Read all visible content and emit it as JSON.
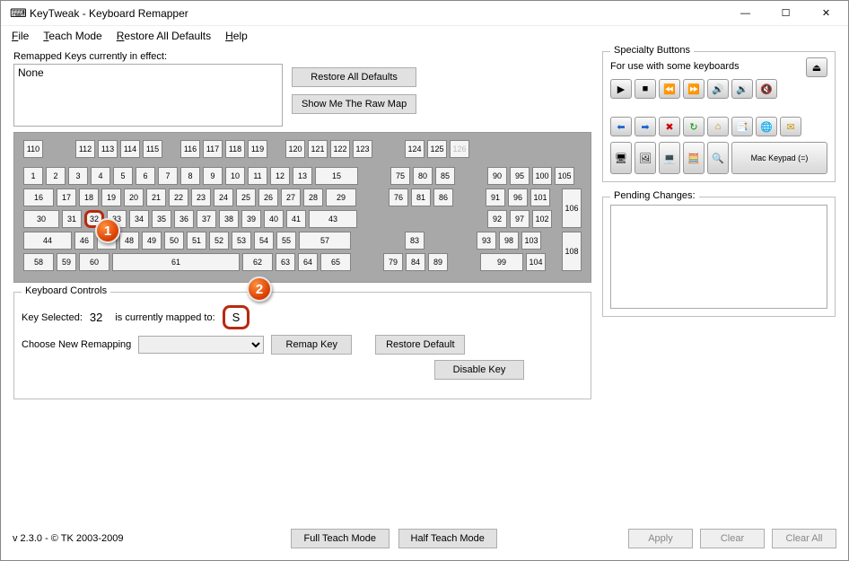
{
  "title": "KeyTweak -   Keyboard Remapper",
  "menu": {
    "file": "File",
    "teach": "Teach Mode",
    "restore": "Restore All Defaults",
    "help": "Help"
  },
  "remapped": {
    "label": "Remapped Keys currently in effect:",
    "value": "None"
  },
  "btn": {
    "restore_defaults": "Restore All Defaults",
    "show_raw": "Show Me The Raw Map",
    "remap": "Remap Key",
    "restore_default": "Restore Default",
    "disable": "Disable Key",
    "full_teach": "Full Teach Mode",
    "half_teach": "Half Teach Mode",
    "apply": "Apply",
    "clear": "Clear",
    "clear_all": "Clear All",
    "mac": "Mac Keypad (=)"
  },
  "controls": {
    "legend": "Keyboard Controls",
    "key_selected_label": "Key Selected:",
    "key_selected": "32",
    "mapped_label": "is currently mapped to:",
    "mapped_value": "S",
    "remap_label": "Choose New Remapping"
  },
  "specialty": {
    "legend": "Specialty Buttons",
    "note": "For use with some keyboards"
  },
  "pending": {
    "legend": "Pending Changes:"
  },
  "version": "v 2.3.0 - © TK 2003-2009",
  "callouts": {
    "c1": "1",
    "c2": "2"
  },
  "keys": {
    "r0a": [
      "110"
    ],
    "r0b": [
      "112",
      "113",
      "114",
      "115"
    ],
    "r0c": [
      "116",
      "117",
      "118",
      "119"
    ],
    "r0d": [
      "120",
      "121",
      "122",
      "123"
    ],
    "r0e": [
      "124",
      "125",
      "126"
    ],
    "r1a": [
      "1",
      "2",
      "3",
      "4",
      "5",
      "6",
      "7",
      "8",
      "9",
      "10",
      "11",
      "12",
      "13",
      "15"
    ],
    "r1b": [
      "75",
      "80",
      "85"
    ],
    "r1c": [
      "90",
      "95",
      "100",
      "105"
    ],
    "r2a": [
      "16",
      "17",
      "18",
      "19",
      "20",
      "21",
      "22",
      "23",
      "24",
      "25",
      "26",
      "27",
      "28",
      "29"
    ],
    "r2b": [
      "76",
      "81",
      "86"
    ],
    "r2c": [
      "91",
      "96",
      "101"
    ],
    "r3a": [
      "30",
      "31",
      "32",
      "33",
      "34",
      "35",
      "36",
      "37",
      "38",
      "39",
      "40",
      "41",
      "43"
    ],
    "r3c": [
      "92",
      "97",
      "102"
    ],
    "r4a": [
      "44",
      "46",
      "47",
      "48",
      "49",
      "50",
      "51",
      "52",
      "53",
      "54",
      "55",
      "57"
    ],
    "r4b": [
      "83"
    ],
    "r4c": [
      "93",
      "98",
      "103"
    ],
    "r5a": [
      "58",
      "59",
      "60",
      "61",
      "62",
      "63",
      "64",
      "65"
    ],
    "r5b": [
      "79",
      "84",
      "89"
    ],
    "r5c": [
      "99",
      "104"
    ],
    "tall1": "106",
    "tall2": "108"
  }
}
